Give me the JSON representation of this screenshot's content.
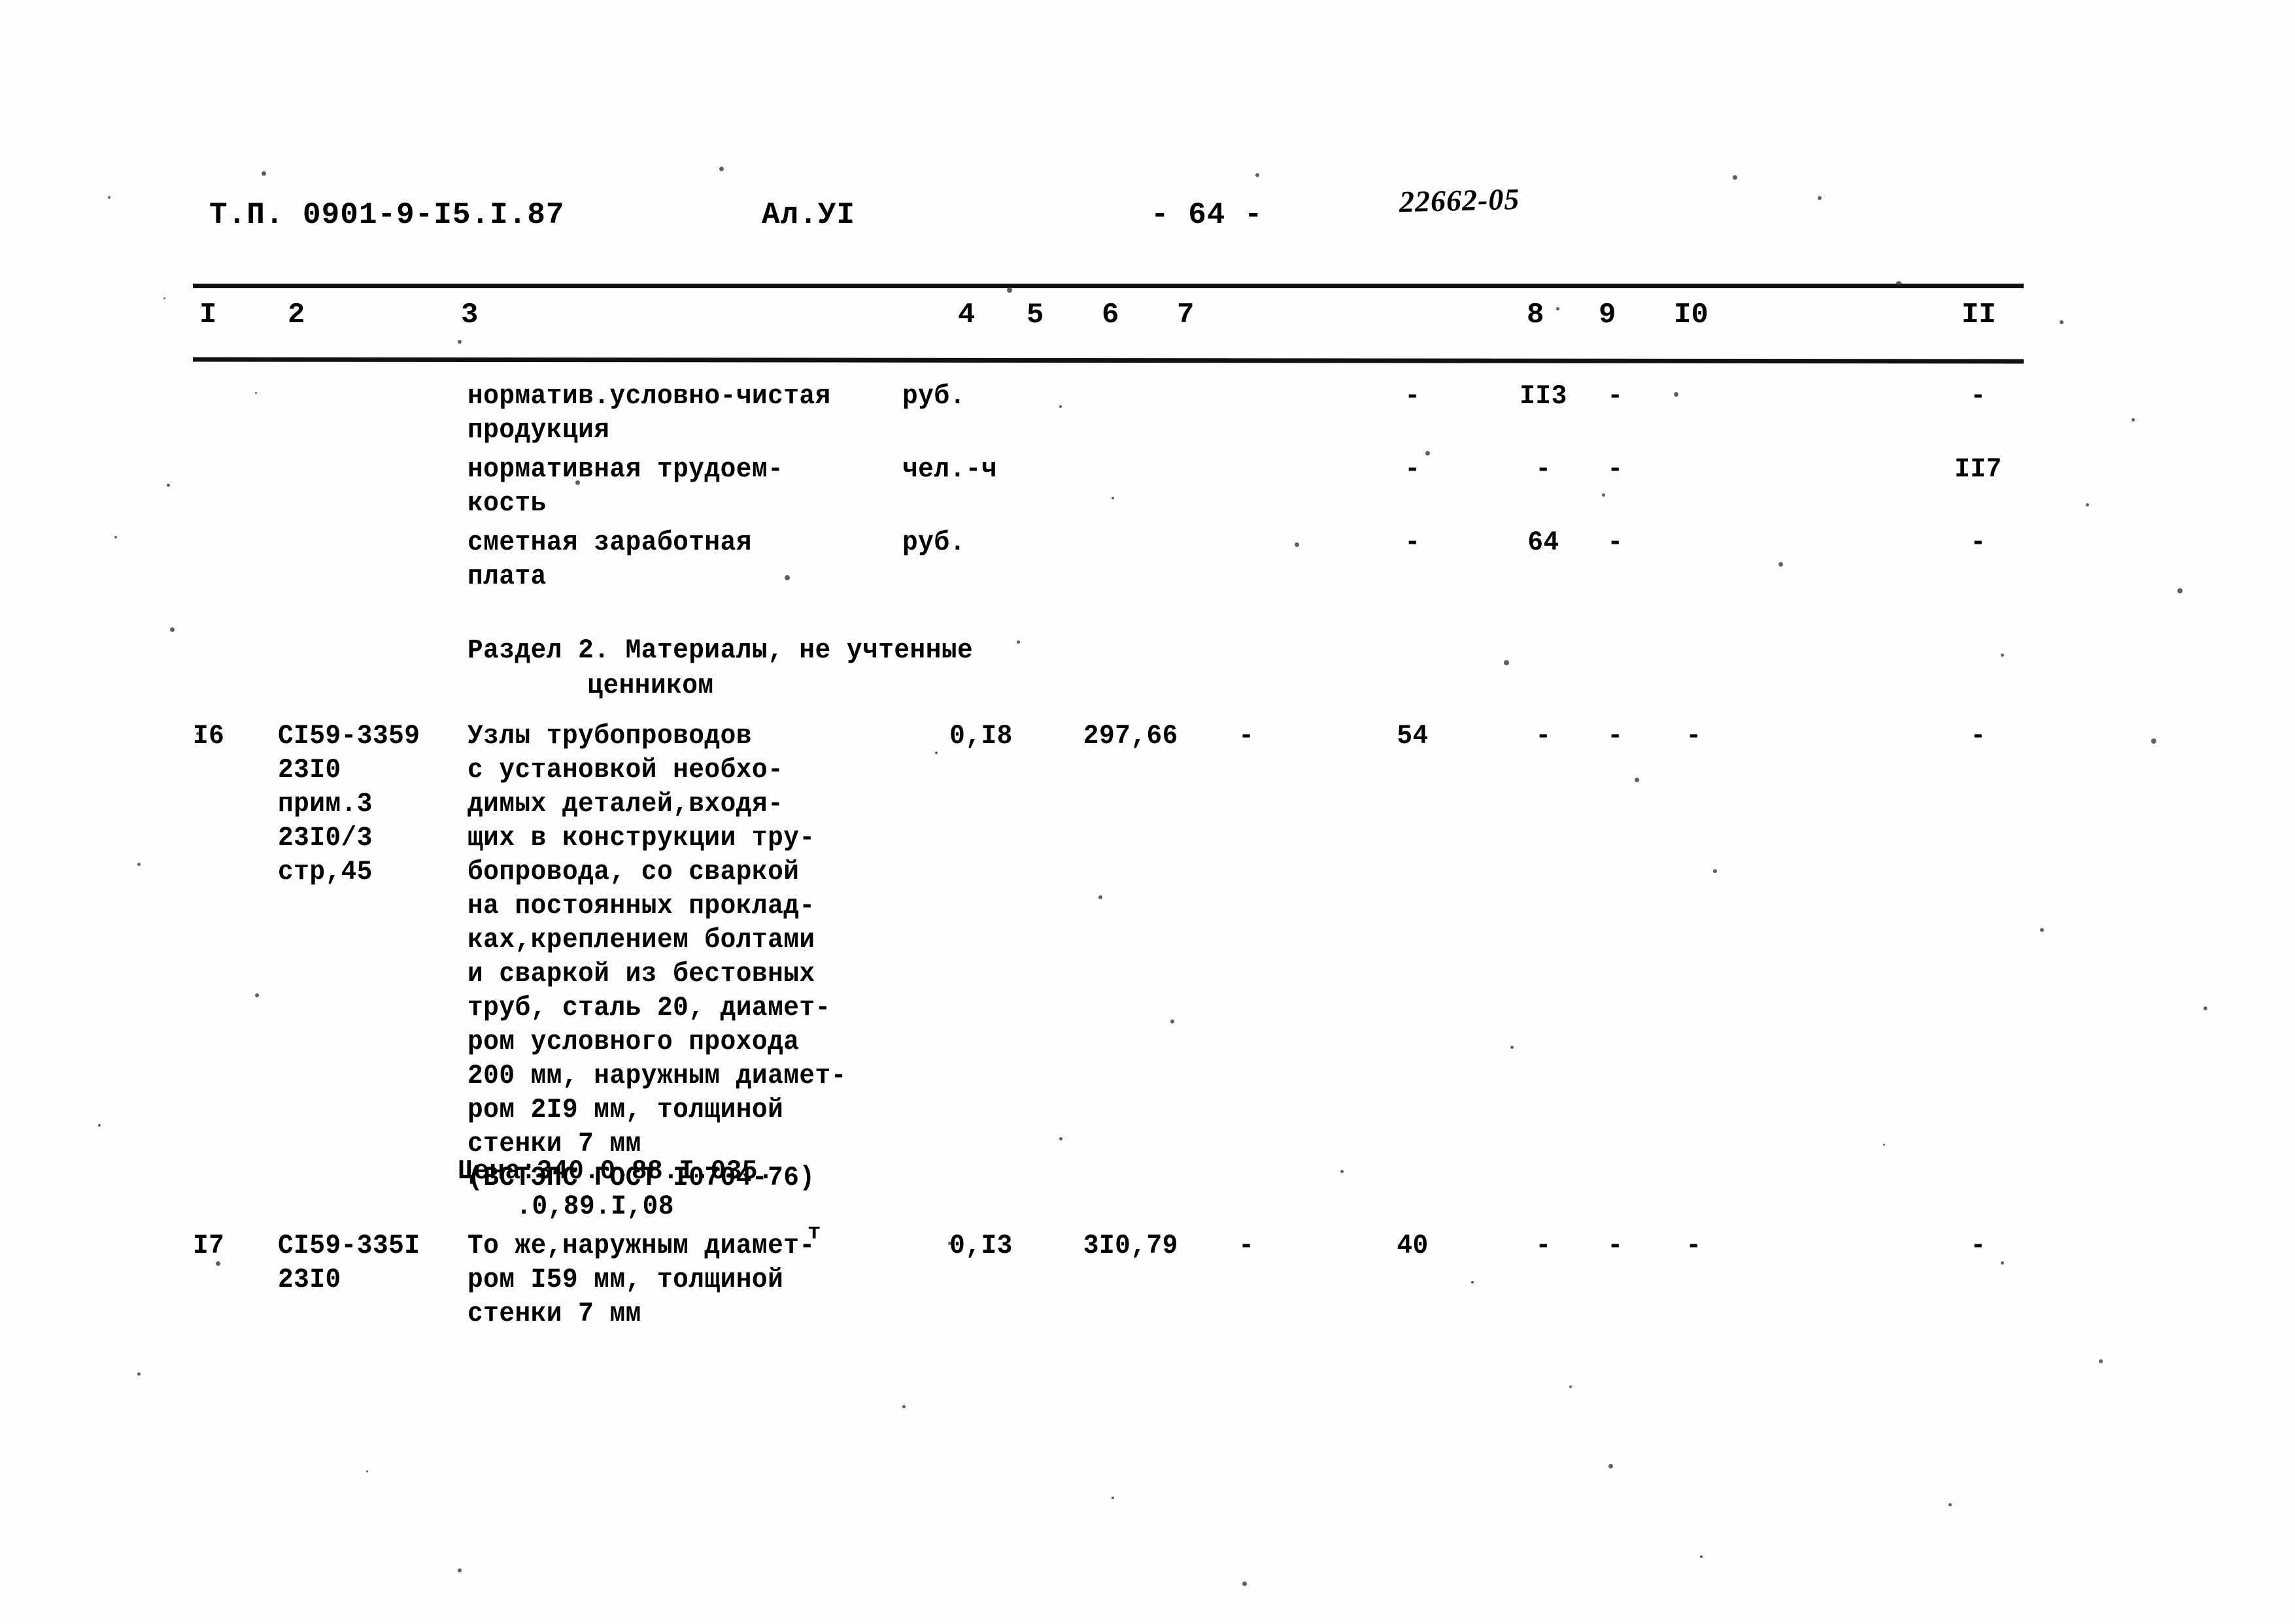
{
  "header": {
    "doc_code": "Т.П. 0901-9-I5.I.87",
    "album": "Ал.УI",
    "page": "- 64 -",
    "stamp": "22662-05"
  },
  "table": {
    "column_headers": [
      "I",
      "2",
      "3",
      "4",
      "5",
      "6",
      "7",
      "8",
      "9",
      "I0",
      "II"
    ],
    "rows": [
      {
        "num": "",
        "code": "",
        "desc": "норматив.условно-чистая\nпродукция",
        "unit": "руб.",
        "c4": "",
        "c5": "",
        "c6": "",
        "c7": "-",
        "c8": "II3",
        "c9": "-",
        "c10": "",
        "c11": "-"
      },
      {
        "num": "",
        "code": "",
        "desc": "нормативная трудоем-\nкость",
        "unit": "чел.-ч",
        "c4": "",
        "c5": "",
        "c6": "",
        "c7": "-",
        "c8": "-",
        "c9": "-",
        "c10": "",
        "c11": "II7"
      },
      {
        "num": "",
        "code": "",
        "desc": "сметная заработная\nплата",
        "unit": "руб.",
        "c4": "",
        "c5": "",
        "c6": "",
        "c7": "-",
        "c8": "64",
        "c9": "-",
        "c10": "",
        "c11": "-"
      },
      {
        "num": "I6",
        "code": "СI59-3359\n23I0\nприм.3\n23I0/3\nстр,45",
        "desc": "Узлы трубопроводов\nс установкой необхо-\nдимых деталей,входя-\nщих в конструкции тру-\nбопровода, со сваркой\nна постоянных проклад-\nках,креплением болтами\nи сваркой из бестовных\nтруб, сталь 20, диамет-\nром условного прохода\n200 мм, наружным диамет-\nром 2I9 мм, толщиной\nстенки 7 мм\n(ВСТЭПС ГОСТ I0704-76)",
        "unit": "",
        "c4": "0,I8",
        "c5": "297,66",
        "c6": "-",
        "c7": "54",
        "c8": "-",
        "c9": "-",
        "c10": "-",
        "c11": "-"
      },
      {
        "num": "I7",
        "code": "СI59-335I\n23I0",
        "desc": "То же,наружным диамет-\nром I59 мм, толщиной\nстенки 7 мм",
        "unit": "",
        "c4": "0,I3",
        "c5": "3I0,79",
        "c6": "-",
        "c7": "40",
        "c8": "-",
        "c9": "-",
        "c10": "-",
        "c11": "-"
      }
    ],
    "section": {
      "line1": "Раздел 2. Материалы, не учтенные",
      "line2": "ценником"
    },
    "price_note": {
      "line1": "Цена:340.0,88.I.035.",
      "line2": ".0,89.I,08",
      "mark": "т"
    }
  }
}
